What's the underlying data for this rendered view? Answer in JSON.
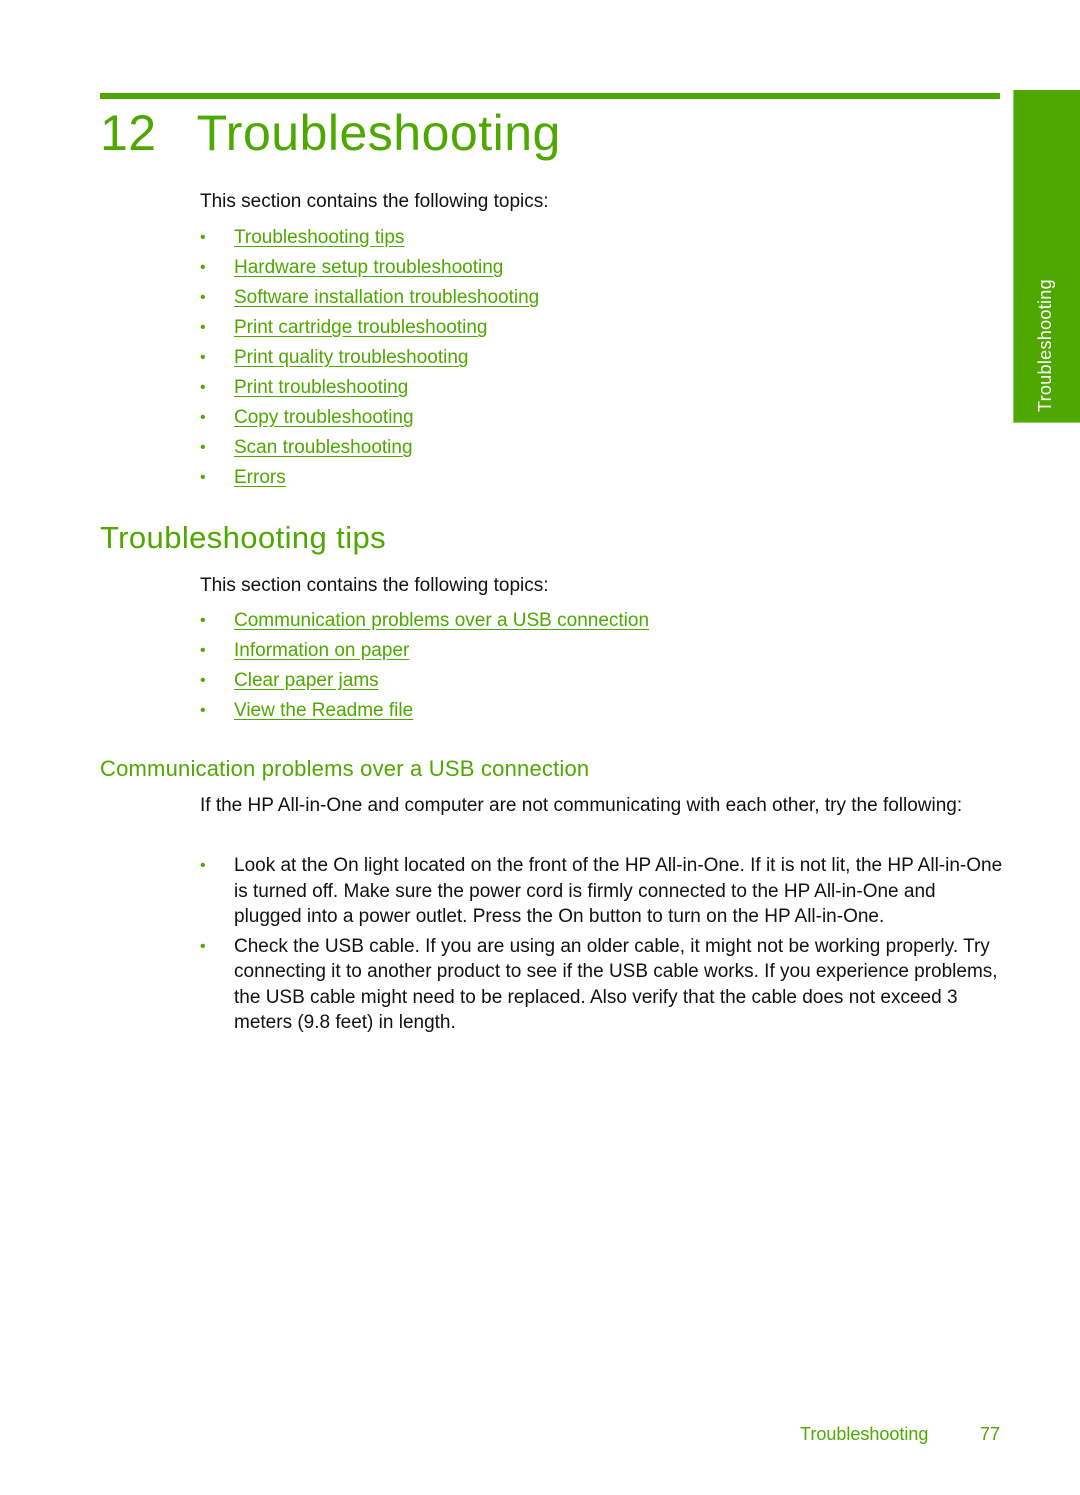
{
  "chapter": {
    "number": "12",
    "title": "Troubleshooting"
  },
  "side_tab": {
    "label": "Troubleshooting"
  },
  "chapter_intro": "This section contains the following topics:",
  "chapter_topics": [
    {
      "label": "Troubleshooting tips"
    },
    {
      "label": "Hardware setup troubleshooting"
    },
    {
      "label": "Software installation troubleshooting"
    },
    {
      "label": "Print cartridge troubleshooting"
    },
    {
      "label": "Print quality troubleshooting"
    },
    {
      "label": "Print troubleshooting"
    },
    {
      "label": "Copy troubleshooting"
    },
    {
      "label": "Scan troubleshooting"
    },
    {
      "label": "Errors"
    }
  ],
  "section": {
    "title": "Troubleshooting tips",
    "intro": "This section contains the following topics:",
    "topics": [
      {
        "label": "Communication problems over a USB connection"
      },
      {
        "label": "Information on paper"
      },
      {
        "label": "Clear paper jams"
      },
      {
        "label": "View the Readme file"
      }
    ]
  },
  "subsection": {
    "title": "Communication problems over a USB connection",
    "paragraph": "If the HP All-in-One and computer are not communicating with each other, try the following:",
    "steps": [
      {
        "text": "Look at the On light located on the front of the HP All-in-One. If it is not lit, the HP All-in-One is turned off. Make sure the power cord is firmly connected to the HP All-in-One and plugged into a power outlet. Press the On button to turn on the HP All-in-One."
      },
      {
        "text": "Check the USB cable. If you are using an older cable, it might not be working properly. Try connecting it to another product to see if the USB cable works. If you experience problems, the USB cable might need to be replaced. Also verify that the cable does not exceed 3 meters (9.8 feet) in length."
      }
    ]
  },
  "footer": {
    "label": "Troubleshooting",
    "page": "77"
  },
  "colors": {
    "accent": "#4fa800",
    "text": "#111111"
  }
}
